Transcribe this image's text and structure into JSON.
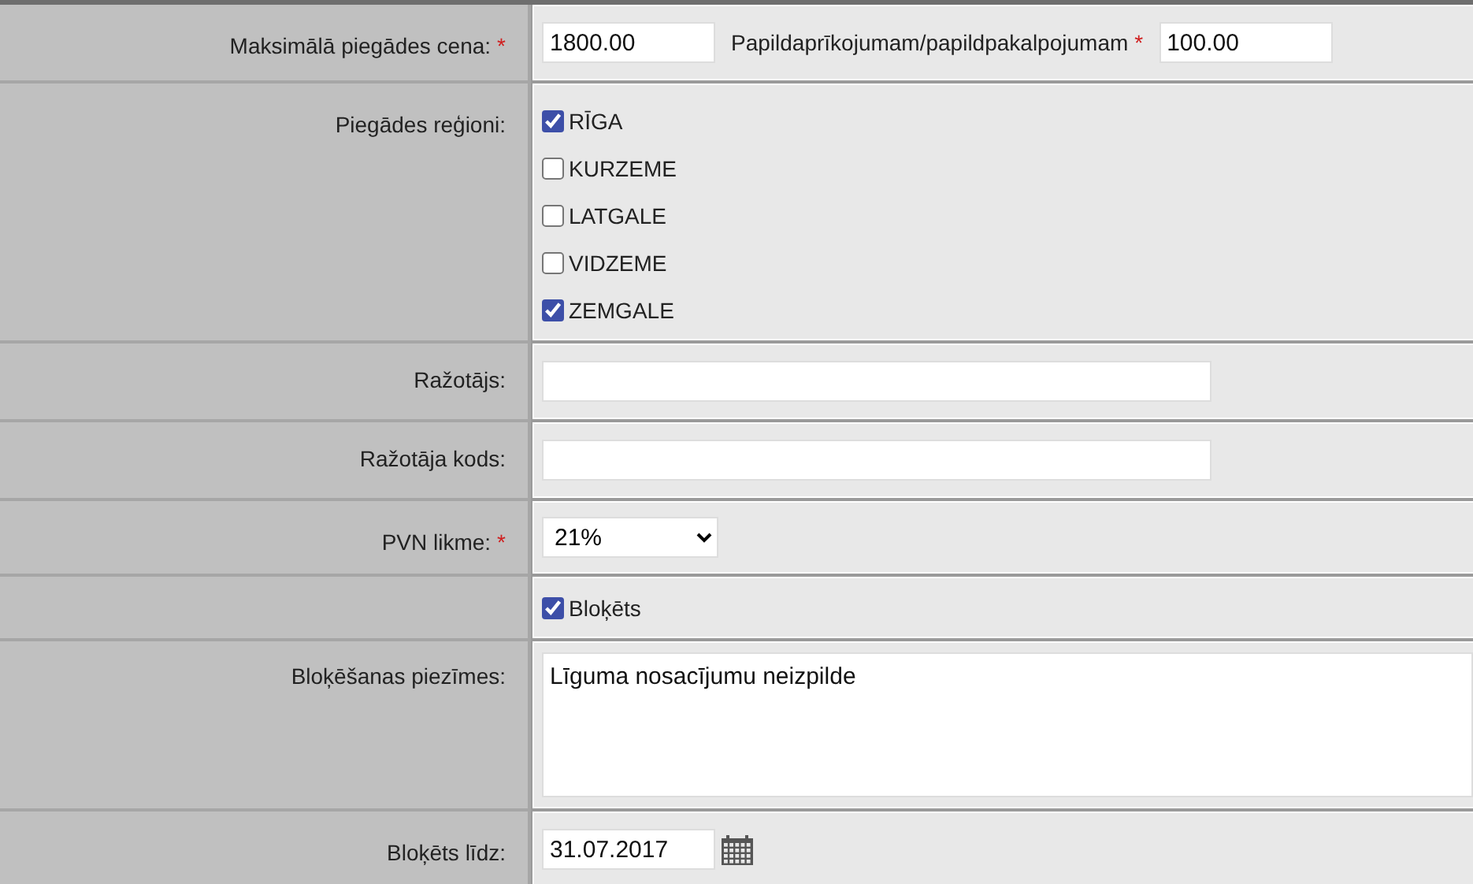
{
  "rows": [
    {
      "kind": "price",
      "label": "Maksimālā piegādes cena:",
      "required_mark": "*",
      "value": "1800.00",
      "extra_label": "Papildaprīkojumam/papildpakalpojumam",
      "extra_required_mark": "*",
      "extra_value": "100.00"
    },
    {
      "kind": "checklist",
      "label": "Piegādes reģioni:",
      "options": [
        {
          "label": "RĪGA",
          "checked": true
        },
        {
          "label": "KURZEME",
          "checked": false
        },
        {
          "label": "LATGALE",
          "checked": false
        },
        {
          "label": "VIDZEME",
          "checked": false
        },
        {
          "label": "ZEMGALE",
          "checked": true
        }
      ]
    },
    {
      "kind": "text",
      "label": "Ražotājs:"
    },
    {
      "kind": "text",
      "label": "Ražotāja kods:"
    },
    {
      "kind": "select",
      "label": "PVN likme:",
      "required_mark": "*",
      "value": "21%"
    },
    {
      "kind": "checkbox",
      "option": {
        "label": "Bloķēts",
        "checked": true
      }
    },
    {
      "kind": "textarea",
      "label": "Bloķēšanas piezīmes:",
      "value": "Līguma nosacījumu neizpilde"
    },
    {
      "kind": "date",
      "label": "Bloķēts līdz:",
      "value": "31.07.2017"
    }
  ]
}
